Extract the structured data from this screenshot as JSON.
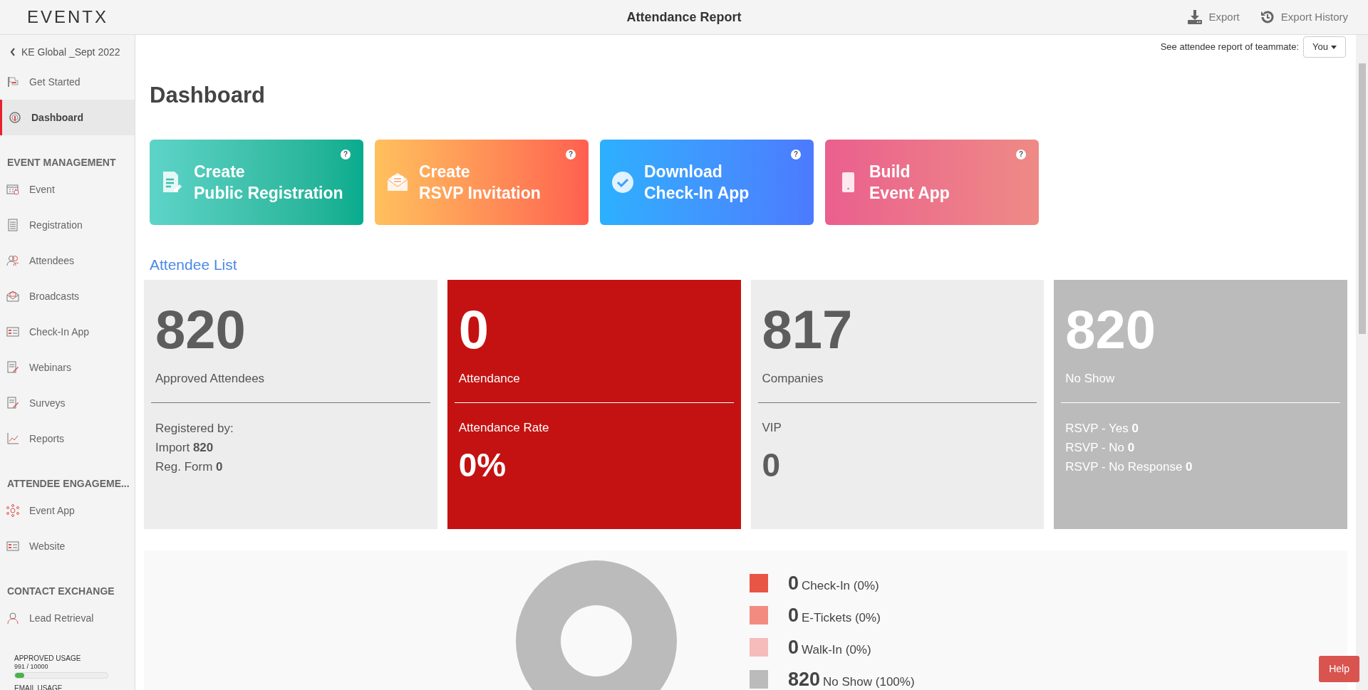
{
  "header": {
    "logo": "EVENTX",
    "title": "Attendance Report",
    "actions": [
      {
        "kind": "export",
        "label": "Export"
      },
      {
        "kind": "history",
        "label": "Export History"
      }
    ]
  },
  "sidebar": {
    "back": "KE Global _Sept 2022",
    "sections": [
      {
        "items": [
          {
            "label": "Get Started",
            "selected": false
          },
          {
            "label": "Dashboard",
            "selected": true
          }
        ]
      },
      {
        "title": "EVENT MANAGEMENT",
        "items": [
          {
            "label": "Event",
            "selected": false
          },
          {
            "label": "Registration",
            "selected": false
          },
          {
            "label": "Attendees",
            "selected": false
          },
          {
            "label": "Broadcasts",
            "selected": false
          },
          {
            "label": "Check-In App",
            "selected": false
          },
          {
            "label": "Webinars",
            "selected": false
          },
          {
            "label": "Surveys",
            "selected": false
          },
          {
            "label": "Reports",
            "selected": false
          }
        ]
      },
      {
        "title": "ATTENDEE ENGAGEME...",
        "items": [
          {
            "label": "Event App",
            "selected": false
          },
          {
            "label": "Website",
            "selected": false
          }
        ]
      },
      {
        "title": "CONTACT EXCHANGE",
        "items": [
          {
            "label": "Lead Retrieval",
            "selected": false
          }
        ]
      }
    ],
    "usage": [
      {
        "label": "APPROVED USAGE",
        "reading": "991 / 10000",
        "level": 0.0991
      },
      {
        "label": "EMAIL USAGE"
      }
    ]
  },
  "teammate": {
    "label": "See attendee report of teammate:",
    "value": "You"
  },
  "heading": "Dashboard",
  "action_cards": [
    {
      "kind": "form",
      "line1": "Create",
      "line2": "Public Registration",
      "help": "?"
    },
    {
      "kind": "envelope",
      "line1": "Create",
      "line2": "RSVP Invitation",
      "help": "?"
    },
    {
      "kind": "check",
      "line1": "Download",
      "line2": "Check-In App",
      "help": "?"
    },
    {
      "kind": "phone",
      "line1": "Build",
      "line2": "Event App",
      "help": "?"
    }
  ],
  "attendee_list": {
    "title": "Attendee List",
    "cards": [
      {
        "kind": "light",
        "value": "820",
        "label": "Approved Attendees",
        "lines": [
          "Registered by:",
          "Import **820**",
          "Reg. Form **0**"
        ]
      },
      {
        "kind": "red",
        "value": "0",
        "label": "Attendance",
        "sub_label": "Attendance Rate",
        "sub_value": "0%"
      },
      {
        "kind": "light",
        "value": "817",
        "label": "Companies",
        "sub_label": "VIP",
        "sub_value": "0"
      },
      {
        "kind": "gray",
        "value": "820",
        "label": "No Show",
        "lines": [
          "RSVP - Yes **0**",
          "RSVP - No **0**",
          "RSVP - No Response **0**"
        ]
      }
    ]
  },
  "attendance_chart": {
    "chart_data": {
      "type": "donut",
      "categories": [
        "Check-In (0%)",
        "E-Tickets (0%)",
        "Walk-In (0%)",
        "No Show (100%)"
      ],
      "values": [
        0,
        0,
        0,
        100
      ]
    },
    "legend": [
      {
        "count": "0",
        "color": "#e85545"
      },
      {
        "count": "0",
        "color": "#f28c80"
      },
      {
        "count": "0",
        "color": "#f5bcbc"
      },
      {
        "count": "820",
        "color": "#bbbbbb"
      }
    ]
  },
  "help_button": "Help"
}
